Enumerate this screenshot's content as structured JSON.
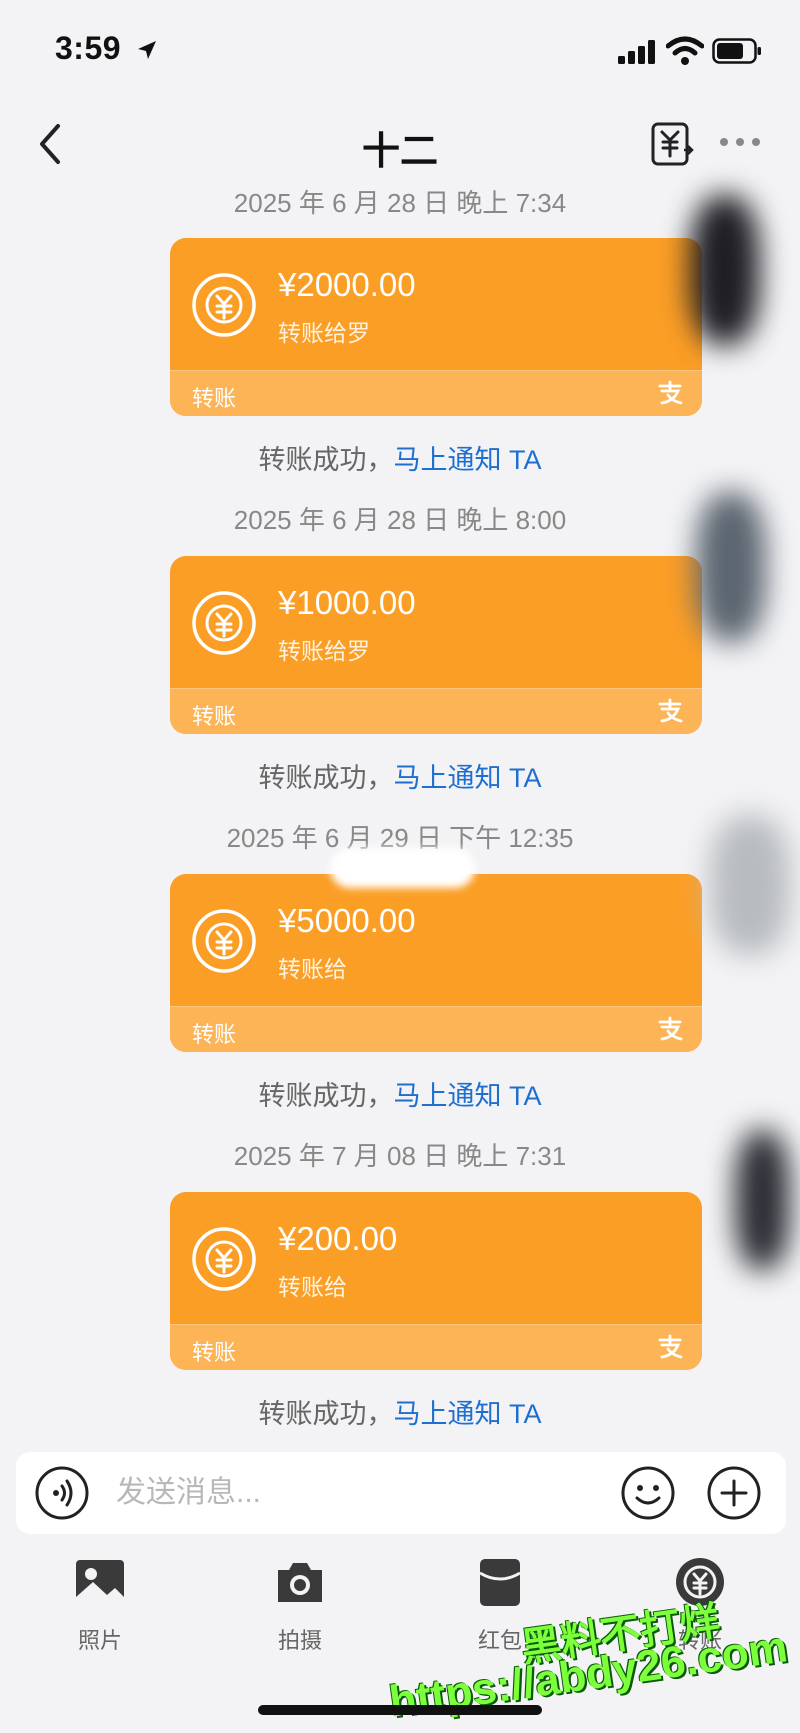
{
  "status_bar": {
    "time": "3:59"
  },
  "header": {
    "title": "十二"
  },
  "messages": [
    {
      "timestamp": "2025 年 6 月 28 日 晚上 7:34",
      "amount": "¥2000.00",
      "recipient": "转账给罗",
      "type": "转账",
      "status": "转账成功，",
      "notify": "马上通知 TA"
    },
    {
      "timestamp": "2025 年 6 月 28 日 晚上 8:00",
      "amount": "¥1000.00",
      "recipient": "转账给罗",
      "type": "转账",
      "status": "转账成功，",
      "notify": "马上通知 TA"
    },
    {
      "timestamp": "2025 年 6 月 29 日 下午 12:35",
      "amount": "¥5000.00",
      "recipient": "转账给",
      "type": "转账",
      "status": "转账成功，",
      "notify": "马上通知 TA"
    },
    {
      "timestamp": "2025 年 7 月 08 日 晚上 7:31",
      "amount": "¥200.00",
      "recipient": "转账给",
      "type": "转账",
      "status": "转账成功，",
      "notify": "马上通知 TA"
    }
  ],
  "input": {
    "placeholder": "发送消息..."
  },
  "toolbar": {
    "photo": "照片",
    "camera": "拍摄",
    "red_packet": "红包",
    "transfer": "转账"
  },
  "watermark": {
    "line1": "黑料不打烊",
    "line2": "https://abdy26.com"
  },
  "colors": {
    "card": "#fb9e26",
    "card_footer": "#fcb456",
    "link": "#1e6fd0",
    "background": "#f3f3f5"
  }
}
